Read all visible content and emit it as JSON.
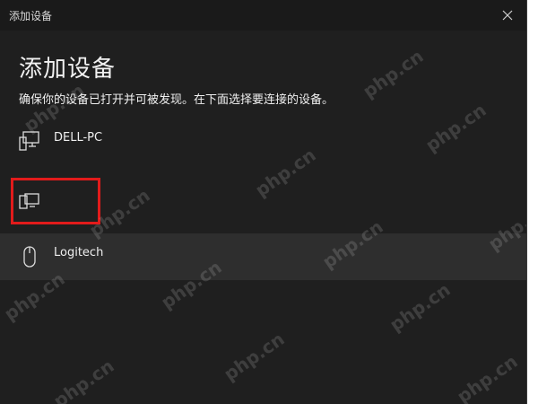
{
  "window": {
    "title": "添加设备",
    "close_icon": "close-icon"
  },
  "main": {
    "heading": "添加设备",
    "instruction": "确保你的设备已打开并可被发现。在下面选择要连接的设备。"
  },
  "devices": [
    {
      "label": "DELL-PC",
      "icon": "computer-icon"
    },
    {
      "label": "",
      "icon": "display-device-icon"
    },
    {
      "label": "Logitech",
      "icon": "mouse-icon"
    }
  ],
  "watermark": {
    "text": "php.cn"
  },
  "colors": {
    "window_bg": "#1f1f1f",
    "selected_row_bg": "#2e2e2e",
    "highlight_border": "#e21b1b"
  }
}
